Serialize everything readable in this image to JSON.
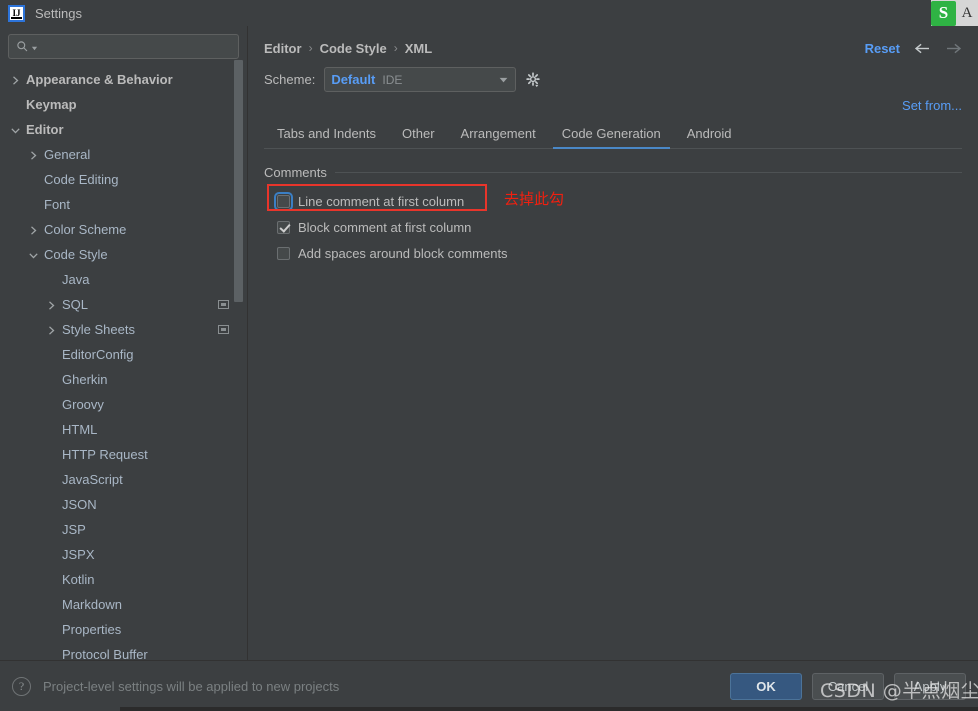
{
  "window": {
    "title": "Settings",
    "logo_icon": "intellij-idea-logo",
    "ime": {
      "sogou_icon": "sogou-pinyin-icon",
      "mode_label": "A"
    }
  },
  "sidebar": {
    "search": {
      "placeholder": "",
      "value": "",
      "icon": "search-icon",
      "dropdown_icon": "chevron-down-icon"
    },
    "items": [
      {
        "label": "Appearance & Behavior",
        "indent": 0,
        "arrow": "collapsed",
        "bold": true,
        "project_icon": false
      },
      {
        "label": "Keymap",
        "indent": 0,
        "arrow": "none",
        "bold": true,
        "project_icon": false
      },
      {
        "label": "Editor",
        "indent": 0,
        "arrow": "expanded",
        "bold": true,
        "project_icon": false
      },
      {
        "label": "General",
        "indent": 1,
        "arrow": "collapsed",
        "bold": false,
        "project_icon": false
      },
      {
        "label": "Code Editing",
        "indent": 1,
        "arrow": "none",
        "bold": false,
        "project_icon": false
      },
      {
        "label": "Font",
        "indent": 1,
        "arrow": "none",
        "bold": false,
        "project_icon": false
      },
      {
        "label": "Color Scheme",
        "indent": 1,
        "arrow": "collapsed",
        "bold": false,
        "project_icon": false
      },
      {
        "label": "Code Style",
        "indent": 1,
        "arrow": "expanded",
        "bold": false,
        "project_icon": false
      },
      {
        "label": "Java",
        "indent": 2,
        "arrow": "none",
        "bold": false,
        "project_icon": false
      },
      {
        "label": "SQL",
        "indent": 2,
        "arrow": "collapsed",
        "bold": false,
        "project_icon": true
      },
      {
        "label": "Style Sheets",
        "indent": 2,
        "arrow": "collapsed",
        "bold": false,
        "project_icon": true
      },
      {
        "label": "EditorConfig",
        "indent": 2,
        "arrow": "none",
        "bold": false,
        "project_icon": false
      },
      {
        "label": "Gherkin",
        "indent": 2,
        "arrow": "none",
        "bold": false,
        "project_icon": false
      },
      {
        "label": "Groovy",
        "indent": 2,
        "arrow": "none",
        "bold": false,
        "project_icon": false
      },
      {
        "label": "HTML",
        "indent": 2,
        "arrow": "none",
        "bold": false,
        "project_icon": false
      },
      {
        "label": "HTTP Request",
        "indent": 2,
        "arrow": "none",
        "bold": false,
        "project_icon": false
      },
      {
        "label": "JavaScript",
        "indent": 2,
        "arrow": "none",
        "bold": false,
        "project_icon": false
      },
      {
        "label": "JSON",
        "indent": 2,
        "arrow": "none",
        "bold": false,
        "project_icon": false
      },
      {
        "label": "JSP",
        "indent": 2,
        "arrow": "none",
        "bold": false,
        "project_icon": false
      },
      {
        "label": "JSPX",
        "indent": 2,
        "arrow": "none",
        "bold": false,
        "project_icon": false
      },
      {
        "label": "Kotlin",
        "indent": 2,
        "arrow": "none",
        "bold": false,
        "project_icon": false
      },
      {
        "label": "Markdown",
        "indent": 2,
        "arrow": "none",
        "bold": false,
        "project_icon": false
      },
      {
        "label": "Properties",
        "indent": 2,
        "arrow": "none",
        "bold": false,
        "project_icon": false
      },
      {
        "label": "Protocol Buffer",
        "indent": 2,
        "arrow": "none",
        "bold": false,
        "project_icon": false
      }
    ]
  },
  "main": {
    "breadcrumb": [
      "Editor",
      "Code Style",
      "XML"
    ],
    "breadcrumb_separator": "›",
    "reset_label": "Reset",
    "back_icon": "arrow-left-icon",
    "forward_icon": "arrow-right-icon",
    "scheme": {
      "label": "Scheme:",
      "value": "Default",
      "scope": "IDE",
      "dropdown_icon": "chevron-down-icon",
      "gear_icon": "gear-icon"
    },
    "set_from_label": "Set from...",
    "tabs": [
      {
        "label": "Tabs and Indents",
        "active": false
      },
      {
        "label": "Other",
        "active": false
      },
      {
        "label": "Arrangement",
        "active": false
      },
      {
        "label": "Code Generation",
        "active": true
      },
      {
        "label": "Android",
        "active": false
      }
    ],
    "group": {
      "title": "Comments",
      "checkboxes": [
        {
          "label": "Line comment at first column",
          "checked": false,
          "focused": true
        },
        {
          "label": "Block comment at first column",
          "checked": true,
          "focused": false
        },
        {
          "label": "Add spaces around block comments",
          "checked": false,
          "focused": false
        }
      ]
    },
    "annotation": {
      "text": "去掉此勾",
      "color": "#f02010"
    }
  },
  "footer": {
    "help_icon": "help-question-icon",
    "status": "Project-level settings will be applied to new projects",
    "buttons": [
      {
        "label": "OK",
        "style": "primary"
      },
      {
        "label": "Cancel",
        "style": "normal"
      },
      {
        "label": "Apply",
        "style": "normal"
      }
    ]
  },
  "watermark": {
    "text": "CSDN @半点烟尘"
  },
  "colors": {
    "background": "#3c3f41",
    "accent_blue": "#589df6",
    "tab_underline": "#4a88c7",
    "annotation_red": "#e8352b",
    "primary_button": "#365880"
  }
}
